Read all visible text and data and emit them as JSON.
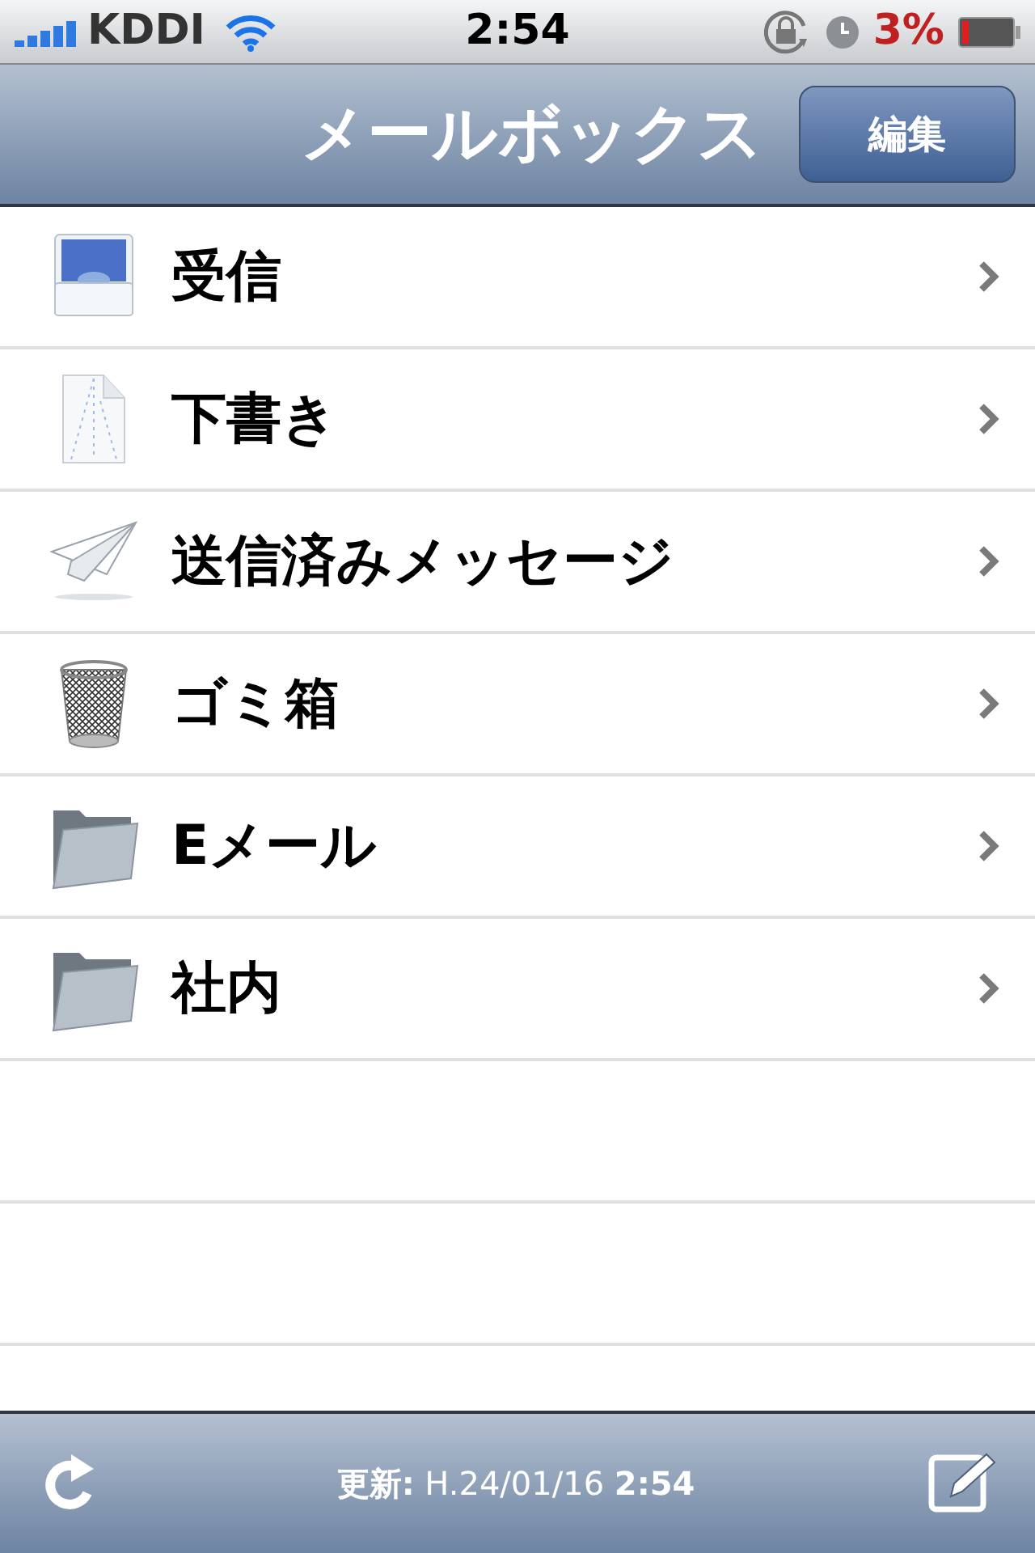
{
  "status_bar": {
    "carrier": "KDDI",
    "time": "2:54",
    "battery": "3%"
  },
  "nav_bar": {
    "title": "メールボックス",
    "edit_button": "編集"
  },
  "mailboxes": [
    {
      "kind": "inbox",
      "label": "受信"
    },
    {
      "kind": "drafts",
      "label": "下書き"
    },
    {
      "kind": "sent",
      "label": "送信済みメッセージ"
    },
    {
      "kind": "trash",
      "label": "ゴミ箱"
    },
    {
      "kind": "folder",
      "label": "Eメール"
    },
    {
      "kind": "folder",
      "label": "社内"
    }
  ],
  "toolbar": {
    "updated": "**更新:** H.24/01/16 **2:54**"
  }
}
